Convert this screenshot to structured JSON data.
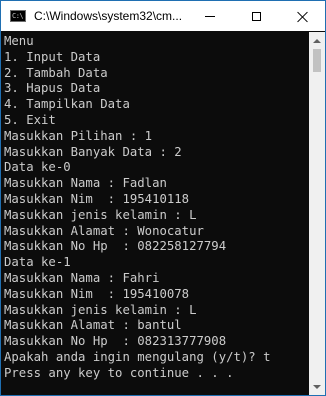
{
  "window": {
    "title": "C:\\Windows\\system32\\cm...",
    "icon": "console-app-icon",
    "icon_glyph": "C:\\",
    "controls": [
      "minimize-icon",
      "maximize-icon",
      "close-icon"
    ]
  },
  "console": {
    "background": "#0c0c0c",
    "foreground": "#cccccc",
    "lines": [
      "Menu",
      "1. Input Data",
      "2. Tambah Data",
      "3. Hapus Data",
      "4. Tampilkan Data",
      "5. Exit",
      "Masukkan Pilihan : 1",
      "Masukkan Banyak Data : 2",
      "Data ke-0",
      "Masukkan Nama : Fadlan",
      "Masukkan Nim  : 195410118",
      "Masukkan jenis kelamin : L",
      "Masukkan Alamat : Wonocatur",
      "Masukkan No Hp  : 082258127794",
      "Data ke-1",
      "Masukkan Nama : Fahri",
      "Masukkan Nim  : 195410078",
      "Masukkan jenis kelamin : L",
      "Masukkan Alamat : bantul",
      "Masukkan No Hp  : 082313777908",
      "Apakah anda ingin mengulang (y/t)? t",
      "Press any key to continue . . ."
    ]
  },
  "scrollbar": {
    "up_icon": "scroll-up-arrow-icon",
    "down_icon": "scroll-down-arrow-icon",
    "thumb_start_fraction": 0.0,
    "thumb_length_fraction": 0.07
  }
}
